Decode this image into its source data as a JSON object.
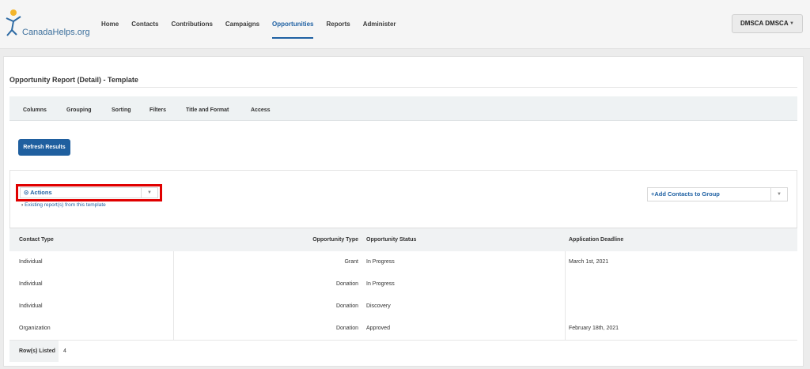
{
  "brand": {
    "name": "CanadaHelps.org"
  },
  "nav": [
    {
      "label": "Home",
      "active": false
    },
    {
      "label": "Contacts",
      "active": false
    },
    {
      "label": "Contributions",
      "active": false
    },
    {
      "label": "Campaigns",
      "active": false
    },
    {
      "label": "Opportunities",
      "active": true
    },
    {
      "label": "Reports",
      "active": false
    },
    {
      "label": "Administer",
      "active": false
    }
  ],
  "user": {
    "label": "DMSCA DMSCA"
  },
  "report": {
    "title": "Opportunity Report (Detail) - Template"
  },
  "tabs": [
    "Columns",
    "Grouping",
    "Sorting",
    "Filters",
    "Title and Format",
    "Access"
  ],
  "refresh_button": "Refresh Results",
  "actions": {
    "label": "Actions",
    "existing_link": "Existing report(s) from this template"
  },
  "add_group": {
    "label": "Add Contacts to Group"
  },
  "table": {
    "headers": [
      "Contact Type",
      "Opportunity Type",
      "Opportunity Status",
      "Application Deadline"
    ],
    "rows": [
      [
        "Individual",
        "Grant",
        "In Progress",
        "March 1st, 2021"
      ],
      [
        "Individual",
        "Donation",
        "In Progress",
        ""
      ],
      [
        "Individual",
        "Donation",
        "Discovery",
        ""
      ],
      [
        "Organization",
        "Donation",
        "Approved",
        "February 18th, 2021"
      ]
    ],
    "rows_listed_label": "Row(s) Listed",
    "rows_listed_value": "4"
  },
  "colors": {
    "accent": "#1f61a3",
    "highlight": "#e00000",
    "button": "#1f5f9f"
  }
}
